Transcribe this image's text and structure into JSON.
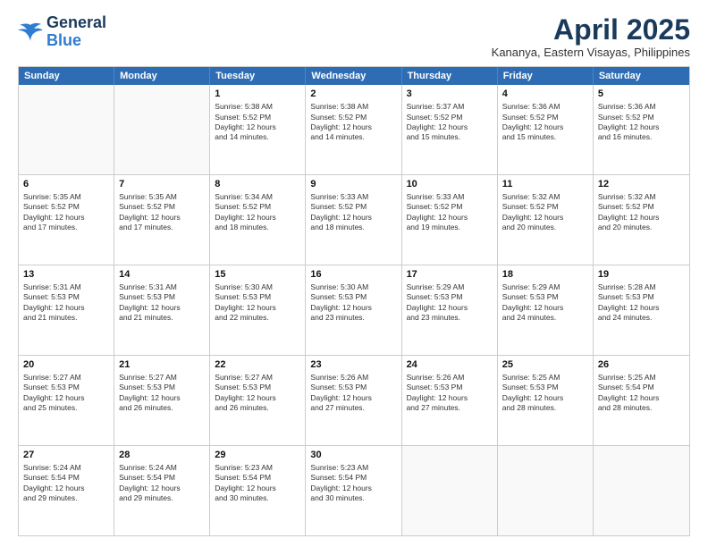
{
  "header": {
    "logo_line1": "General",
    "logo_line2": "Blue",
    "month_title": "April 2025",
    "location": "Kananya, Eastern Visayas, Philippines"
  },
  "calendar": {
    "days_of_week": [
      "Sunday",
      "Monday",
      "Tuesday",
      "Wednesday",
      "Thursday",
      "Friday",
      "Saturday"
    ],
    "rows": [
      [
        {
          "day": "",
          "text": ""
        },
        {
          "day": "",
          "text": ""
        },
        {
          "day": "1",
          "text": "Sunrise: 5:38 AM\nSunset: 5:52 PM\nDaylight: 12 hours\nand 14 minutes."
        },
        {
          "day": "2",
          "text": "Sunrise: 5:38 AM\nSunset: 5:52 PM\nDaylight: 12 hours\nand 14 minutes."
        },
        {
          "day": "3",
          "text": "Sunrise: 5:37 AM\nSunset: 5:52 PM\nDaylight: 12 hours\nand 15 minutes."
        },
        {
          "day": "4",
          "text": "Sunrise: 5:36 AM\nSunset: 5:52 PM\nDaylight: 12 hours\nand 15 minutes."
        },
        {
          "day": "5",
          "text": "Sunrise: 5:36 AM\nSunset: 5:52 PM\nDaylight: 12 hours\nand 16 minutes."
        }
      ],
      [
        {
          "day": "6",
          "text": "Sunrise: 5:35 AM\nSunset: 5:52 PM\nDaylight: 12 hours\nand 17 minutes."
        },
        {
          "day": "7",
          "text": "Sunrise: 5:35 AM\nSunset: 5:52 PM\nDaylight: 12 hours\nand 17 minutes."
        },
        {
          "day": "8",
          "text": "Sunrise: 5:34 AM\nSunset: 5:52 PM\nDaylight: 12 hours\nand 18 minutes."
        },
        {
          "day": "9",
          "text": "Sunrise: 5:33 AM\nSunset: 5:52 PM\nDaylight: 12 hours\nand 18 minutes."
        },
        {
          "day": "10",
          "text": "Sunrise: 5:33 AM\nSunset: 5:52 PM\nDaylight: 12 hours\nand 19 minutes."
        },
        {
          "day": "11",
          "text": "Sunrise: 5:32 AM\nSunset: 5:52 PM\nDaylight: 12 hours\nand 20 minutes."
        },
        {
          "day": "12",
          "text": "Sunrise: 5:32 AM\nSunset: 5:52 PM\nDaylight: 12 hours\nand 20 minutes."
        }
      ],
      [
        {
          "day": "13",
          "text": "Sunrise: 5:31 AM\nSunset: 5:53 PM\nDaylight: 12 hours\nand 21 minutes."
        },
        {
          "day": "14",
          "text": "Sunrise: 5:31 AM\nSunset: 5:53 PM\nDaylight: 12 hours\nand 21 minutes."
        },
        {
          "day": "15",
          "text": "Sunrise: 5:30 AM\nSunset: 5:53 PM\nDaylight: 12 hours\nand 22 minutes."
        },
        {
          "day": "16",
          "text": "Sunrise: 5:30 AM\nSunset: 5:53 PM\nDaylight: 12 hours\nand 23 minutes."
        },
        {
          "day": "17",
          "text": "Sunrise: 5:29 AM\nSunset: 5:53 PM\nDaylight: 12 hours\nand 23 minutes."
        },
        {
          "day": "18",
          "text": "Sunrise: 5:29 AM\nSunset: 5:53 PM\nDaylight: 12 hours\nand 24 minutes."
        },
        {
          "day": "19",
          "text": "Sunrise: 5:28 AM\nSunset: 5:53 PM\nDaylight: 12 hours\nand 24 minutes."
        }
      ],
      [
        {
          "day": "20",
          "text": "Sunrise: 5:27 AM\nSunset: 5:53 PM\nDaylight: 12 hours\nand 25 minutes."
        },
        {
          "day": "21",
          "text": "Sunrise: 5:27 AM\nSunset: 5:53 PM\nDaylight: 12 hours\nand 26 minutes."
        },
        {
          "day": "22",
          "text": "Sunrise: 5:27 AM\nSunset: 5:53 PM\nDaylight: 12 hours\nand 26 minutes."
        },
        {
          "day": "23",
          "text": "Sunrise: 5:26 AM\nSunset: 5:53 PM\nDaylight: 12 hours\nand 27 minutes."
        },
        {
          "day": "24",
          "text": "Sunrise: 5:26 AM\nSunset: 5:53 PM\nDaylight: 12 hours\nand 27 minutes."
        },
        {
          "day": "25",
          "text": "Sunrise: 5:25 AM\nSunset: 5:53 PM\nDaylight: 12 hours\nand 28 minutes."
        },
        {
          "day": "26",
          "text": "Sunrise: 5:25 AM\nSunset: 5:54 PM\nDaylight: 12 hours\nand 28 minutes."
        }
      ],
      [
        {
          "day": "27",
          "text": "Sunrise: 5:24 AM\nSunset: 5:54 PM\nDaylight: 12 hours\nand 29 minutes."
        },
        {
          "day": "28",
          "text": "Sunrise: 5:24 AM\nSunset: 5:54 PM\nDaylight: 12 hours\nand 29 minutes."
        },
        {
          "day": "29",
          "text": "Sunrise: 5:23 AM\nSunset: 5:54 PM\nDaylight: 12 hours\nand 30 minutes."
        },
        {
          "day": "30",
          "text": "Sunrise: 5:23 AM\nSunset: 5:54 PM\nDaylight: 12 hours\nand 30 minutes."
        },
        {
          "day": "",
          "text": ""
        },
        {
          "day": "",
          "text": ""
        },
        {
          "day": "",
          "text": ""
        }
      ]
    ]
  }
}
